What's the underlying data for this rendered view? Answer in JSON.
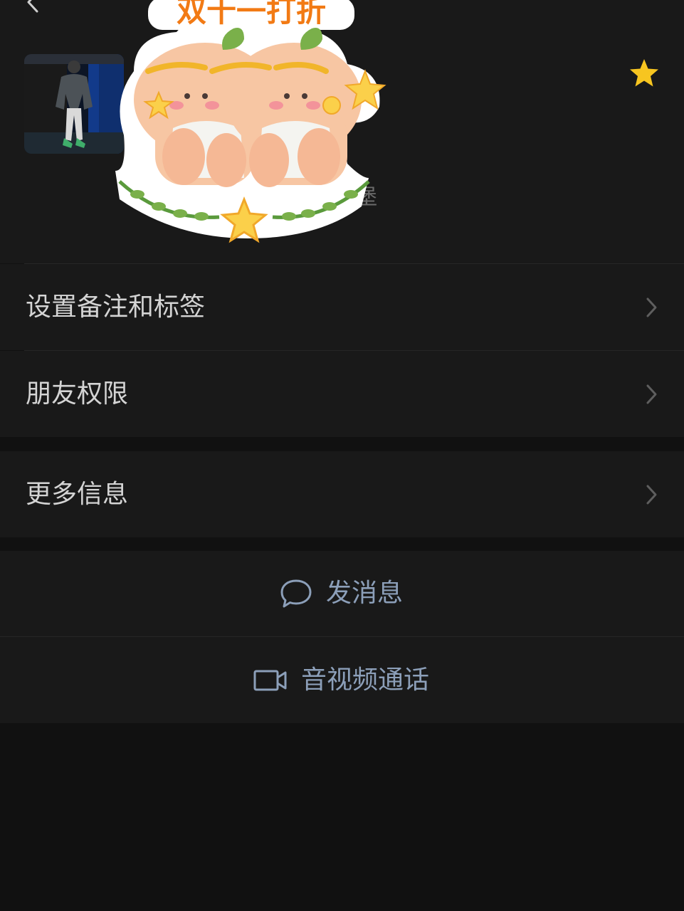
{
  "profile": {
    "region_fragment": "堡",
    "sticker_text": "双十一打折"
  },
  "menu": {
    "remark_tags": "设置备注和标签",
    "friend_permissions": "朋友权限",
    "more_info": "更多信息"
  },
  "actions": {
    "send_message": "发消息",
    "video_call": "音视频通话"
  },
  "icons": {
    "back": "chevron-left-icon",
    "star": "star-icon",
    "chevron": "chevron-right-icon",
    "message": "chat-bubble-icon",
    "video": "video-camera-icon"
  },
  "colors": {
    "background": "#111111",
    "cell": "#191919",
    "star": "#f7c520",
    "action_text": "#8c9fb9"
  }
}
